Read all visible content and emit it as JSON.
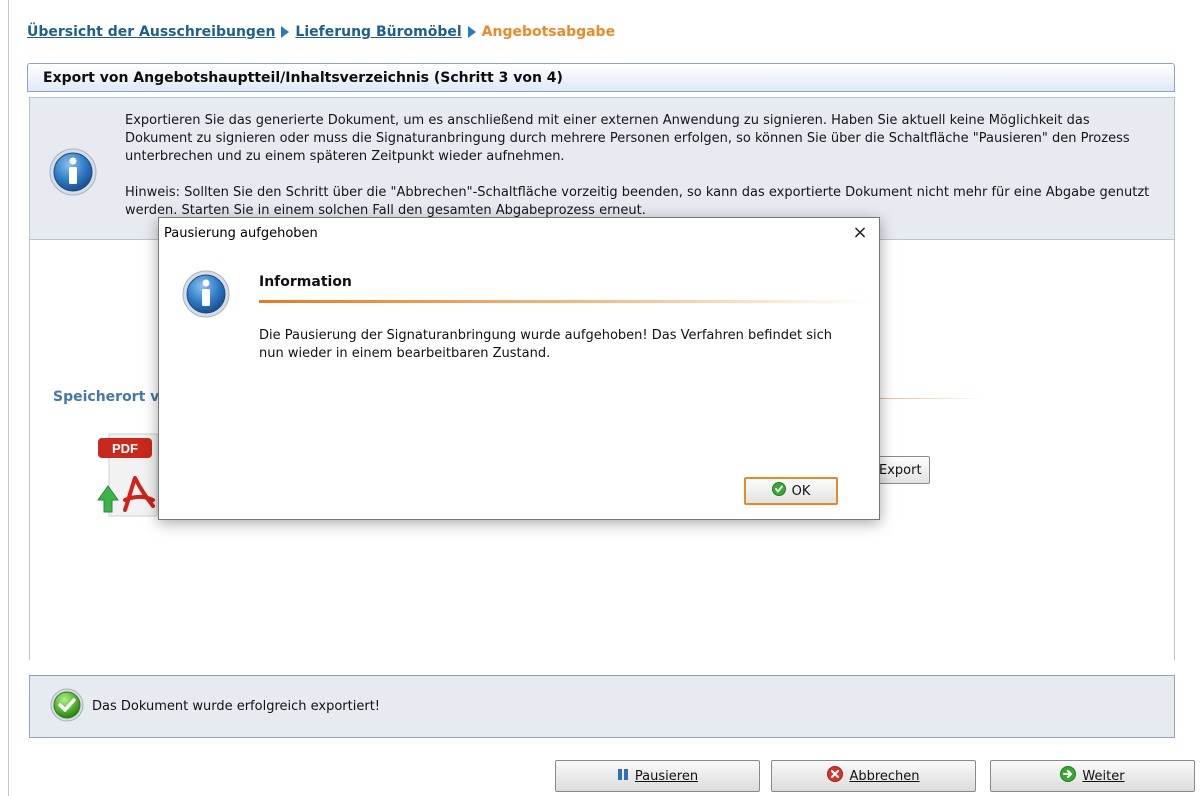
{
  "breadcrumb": {
    "items": [
      "Übersicht der Ausschreibungen",
      "Lieferung Büromöbel"
    ],
    "current": "Angebotsabgabe"
  },
  "panel": {
    "title": "Export von Angebotshauptteil/Inhaltsverzeichnis (Schritt 3 von 4)",
    "info_paragraph_1": "Exportieren Sie das generierte Dokument, um es anschließend mit einer externen Anwendung zu signieren. Haben Sie aktuell keine Möglichkeit das Dokument zu signieren oder muss die Signaturanbringung durch mehrere Personen erfolgen, so können Sie über die Schaltfläche \"Pausieren\" den Prozess unterbrechen und zu einem späteren Zeitpunkt wieder aufnehmen.",
    "info_paragraph_2": "Hinweis: Sollten Sie den Schritt über die \"Abbrechen\"-Schaltfläche vorzeitig beenden, so kann das exportierte Dokument nicht mehr für eine Abgabe genutzt werden. Starten Sie in einem solchen Fall den gesamten Abgabeprozess erneut.",
    "storage_label": "Speicherort v",
    "export_button": "Export",
    "pdf_badge": "PDF"
  },
  "status": {
    "text": "Das Dokument wurde erfolgreich exportiert!"
  },
  "footer": {
    "pause_label": "Pausieren",
    "cancel_label": "Abbrechen",
    "next_label": "Weiter"
  },
  "dialog": {
    "title": "Pausierung aufgehoben",
    "heading": "Information",
    "message_line_1": "Die Pausierung der Signaturanbringung wurde aufgehoben! Das Verfahren befindet sich",
    "message_line_2": "nun wieder in einem bearbeitbaren Zustand.",
    "ok_label": "OK",
    "close_symbol": "×"
  },
  "colors": {
    "link": "#1f5f8f",
    "current": "#ec8a2a",
    "accent_orange": "#e57c1b",
    "panel_bg": "#e7ebf1"
  },
  "icons": [
    "info-icon",
    "pdf-export-icon",
    "check-circle-icon",
    "pause-icon",
    "cancel-icon",
    "next-arrow-icon"
  ]
}
